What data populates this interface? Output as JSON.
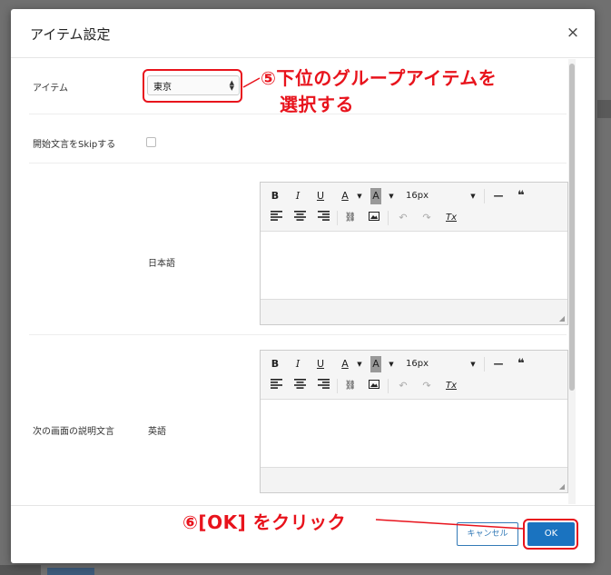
{
  "modal": {
    "title": "アイテム設定",
    "close_glyph": "×"
  },
  "form": {
    "item_label": "アイテム",
    "item_value": "東京",
    "skip_label": "開始文言をSkipする",
    "description_label": "次の画面の説明文言",
    "lang_japanese": "日本語",
    "lang_english": "英語"
  },
  "editor": {
    "bold": "B",
    "italic": "I",
    "underline": "U",
    "text_color": "A",
    "bg_color": "A",
    "font_size": "16px",
    "hr": "—",
    "quote": "❝",
    "link": "🔗",
    "image": "▣",
    "undo": "↶",
    "redo": "↷",
    "clear_format": "Tx"
  },
  "footer": {
    "cancel_label": "キャンセル",
    "ok_label": "OK"
  },
  "annotations": {
    "step5_line1": "⑤下位のグループアイテムを",
    "step5_line2": "選択する",
    "step6": "⑥[OK] をクリック"
  },
  "colors": {
    "annotation": "#e8131c",
    "primary": "#1a73c0"
  }
}
